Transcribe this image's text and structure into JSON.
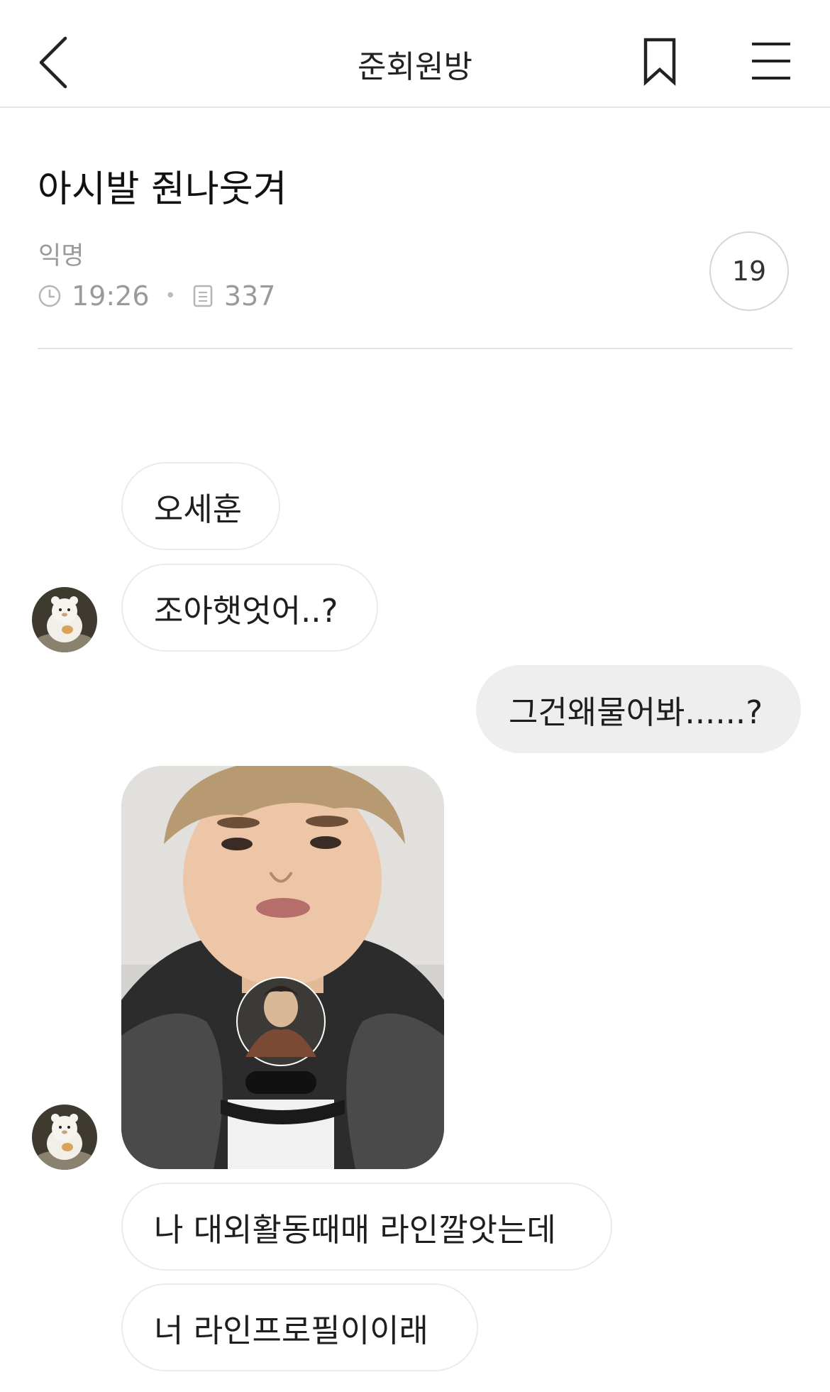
{
  "header": {
    "title": "준회원방",
    "back_icon": "chevron-left-icon",
    "bookmark_icon": "bookmark-icon",
    "menu_icon": "hamburger-menu-icon"
  },
  "post": {
    "title": "아시발 줜나웃겨",
    "author": "익명",
    "time": "19:26",
    "views": "337",
    "comment_count": "19"
  },
  "chat": {
    "messages": [
      {
        "side": "left",
        "text": "오세훈"
      },
      {
        "side": "left",
        "text": "조아햇엇어..?"
      },
      {
        "side": "right",
        "text": "그건왜물어봐......?"
      },
      {
        "side": "left",
        "type": "image"
      },
      {
        "side": "left",
        "text": "나 대외활동때매 라인깔앗는데"
      },
      {
        "side": "left",
        "text": "너 라인프로필이이래"
      }
    ]
  },
  "colors": {
    "divider": "#e2e2e2",
    "bubble_border": "#ebebeb",
    "my_bubble": "#eeeeee",
    "meta_text": "#9a9a9a"
  }
}
